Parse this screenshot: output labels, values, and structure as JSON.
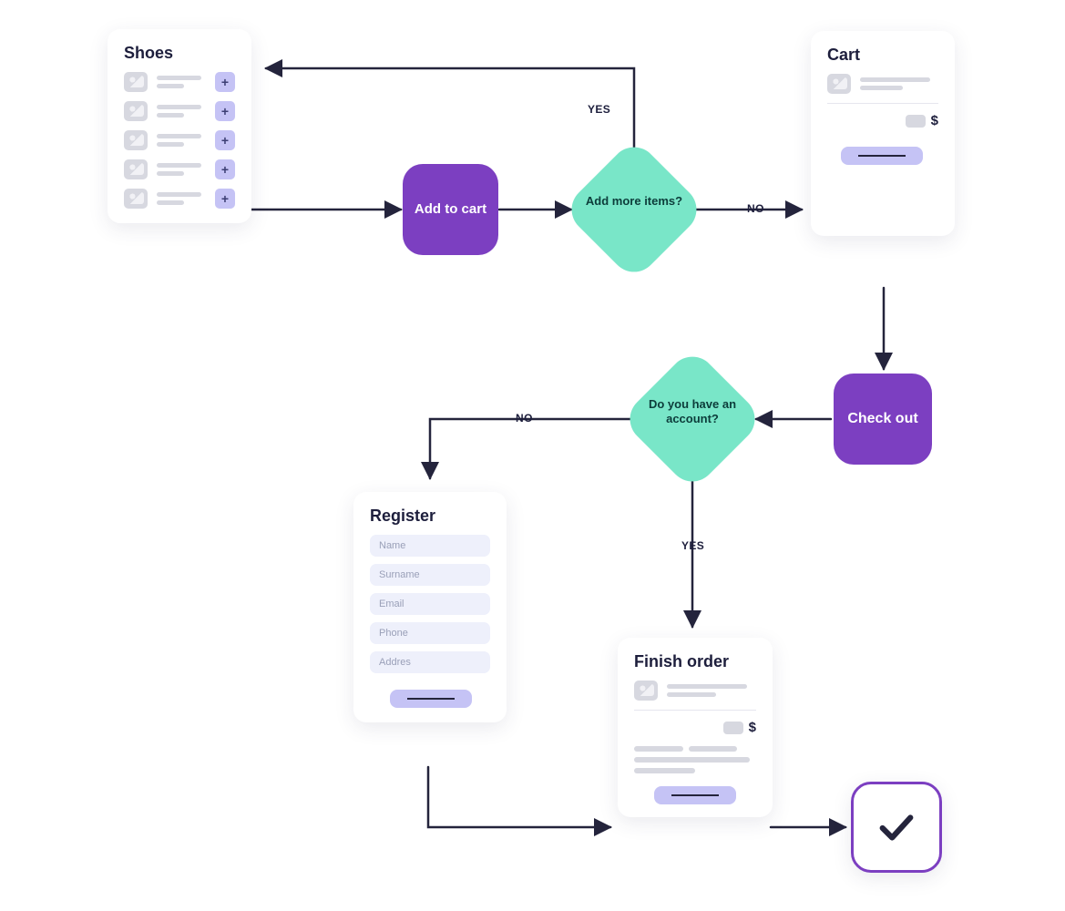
{
  "panels": {
    "shoes": {
      "title": "Shoes",
      "rows": 5,
      "add_icon": "+"
    },
    "cart": {
      "title": "Cart",
      "currency": "$"
    },
    "register": {
      "title": "Register",
      "fields": [
        "Name",
        "Surname",
        "Email",
        "Phone",
        "Addres"
      ]
    },
    "finish": {
      "title": "Finish order",
      "currency": "$"
    }
  },
  "actions": {
    "add_to_cart": "Add to cart",
    "checkout": "Check out"
  },
  "decisions": {
    "add_more": "Add more items?",
    "have_account": "Do you have an account?"
  },
  "labels": {
    "yes": "YES",
    "no": "NO"
  },
  "colors": {
    "purple": "#7c3fc1",
    "mint": "#79e6c8",
    "lilac": "#c5c3f5",
    "arrow": "#24243c"
  }
}
